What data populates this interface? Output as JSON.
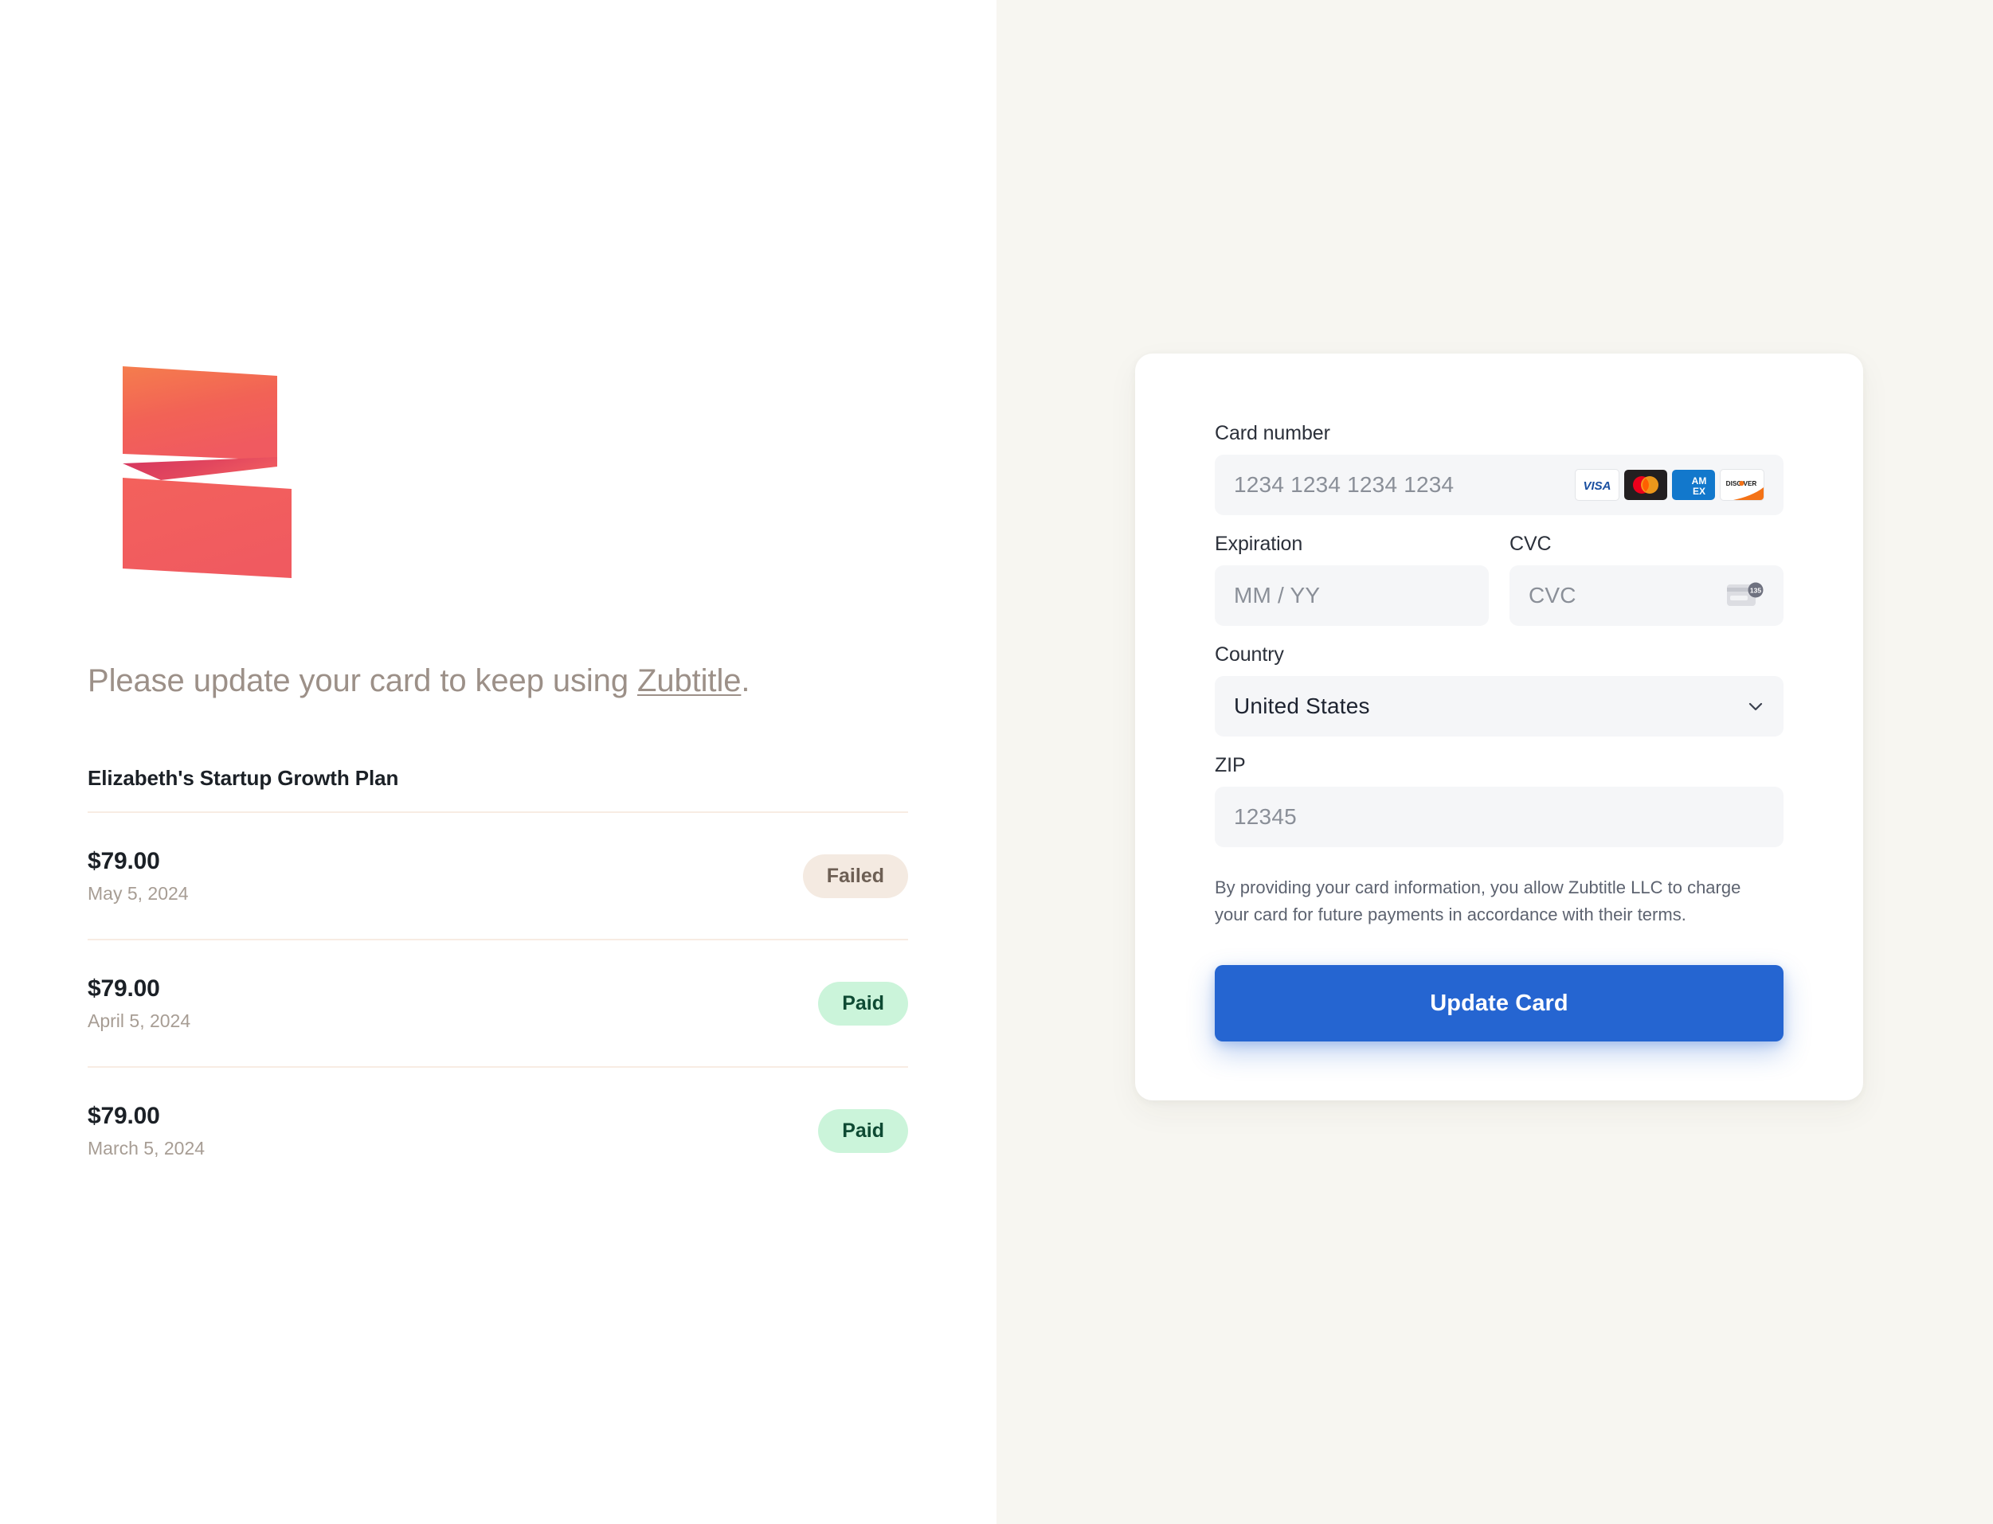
{
  "brand": {
    "name": "Zubtitle",
    "logo_icon": "zubtitle-z-ribbon-logo",
    "colors": {
      "logo_top": "#f4794f",
      "logo_bottom": "#f0555f",
      "logo_fold": "#d43b60",
      "accent_blue": "#2565d1",
      "page_right_bg": "#f7f6f1",
      "divider": "#f8ece3",
      "headline_text": "#9c9088",
      "paid_bg": "#cbf4da",
      "paid_text": "#0e4a33",
      "failed_bg": "#f4eae1",
      "failed_text": "#6d5f54"
    }
  },
  "left": {
    "headline_prefix": "Please update your card to keep using ",
    "headline_link": "Zubtitle",
    "headline_suffix": ".",
    "plan_title": "Elizabeth's Startup Growth Plan",
    "invoices": [
      {
        "amount": "$79.00",
        "date": "May 5, 2024",
        "status": "Failed",
        "status_kind": "failed"
      },
      {
        "amount": "$79.00",
        "date": "April 5, 2024",
        "status": "Paid",
        "status_kind": "paid"
      },
      {
        "amount": "$79.00",
        "date": "March 5, 2024",
        "status": "Paid",
        "status_kind": "paid"
      }
    ]
  },
  "form": {
    "card_number": {
      "label": "Card number",
      "placeholder": "1234 1234 1234 1234",
      "value": "",
      "accepted_brands": [
        "visa",
        "mastercard",
        "amex",
        "discover"
      ],
      "brand_labels": {
        "visa": "VISA",
        "amex_line1": "AM",
        "amex_line2": "EX",
        "discover": "DISC VER"
      }
    },
    "expiration": {
      "label": "Expiration",
      "placeholder": "MM / YY",
      "value": ""
    },
    "cvc": {
      "label": "CVC",
      "placeholder": "CVC",
      "value": "",
      "hint_icon": "credit-card-cvc-icon",
      "hint_digits": "135"
    },
    "country": {
      "label": "Country",
      "selected": "United States",
      "chevron_icon": "chevron-down-icon"
    },
    "zip": {
      "label": "ZIP",
      "placeholder": "12345",
      "value": ""
    },
    "disclaimer": "By providing your card information, you allow Zubtitle LLC to charge your card for future payments in accordance with their terms.",
    "submit_label": "Update Card"
  }
}
